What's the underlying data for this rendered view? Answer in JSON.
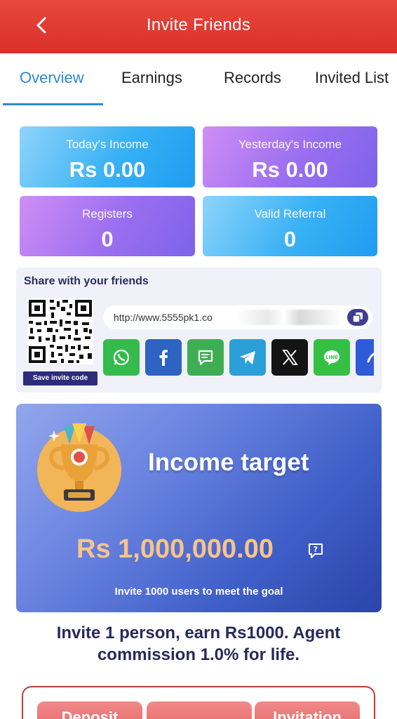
{
  "header": {
    "title": "Invite Friends"
  },
  "tabs": [
    {
      "label": "Overview",
      "active": true
    },
    {
      "label": "Earnings",
      "active": false
    },
    {
      "label": "Records",
      "active": false
    },
    {
      "label": "Invited List",
      "active": false
    }
  ],
  "stats": {
    "today": {
      "label": "Today's Income",
      "value": "Rs  0.00"
    },
    "yesterday": {
      "label": "Yesterday's Income",
      "value": "Rs  0.00"
    },
    "registers": {
      "label": "Registers",
      "value": "0"
    },
    "valid": {
      "label": "Valid Referral",
      "value": "0"
    }
  },
  "share": {
    "title": "Share with your friends",
    "save_code_label": "Save invite code",
    "link": "http://www.5555pk1.co",
    "socials": [
      "whatsapp-icon",
      "facebook-icon",
      "sms-icon",
      "telegram-icon",
      "x-icon",
      "line-icon",
      "more-icon"
    ]
  },
  "target": {
    "title": "Income target",
    "amount": "Rs  1,000,000.00",
    "note": "Invite 1000 users to meet the goal"
  },
  "invite_text": "Invite 1 person, earn Rs1000. Agent commission 1.0% for life.",
  "bottom": {
    "buttons": [
      "Deposit",
      "",
      "Invitation"
    ]
  },
  "colors": {
    "header": "#d9302a",
    "accent": "#2b8ad0",
    "gold": "#f8c489",
    "navy": "#27295a"
  }
}
